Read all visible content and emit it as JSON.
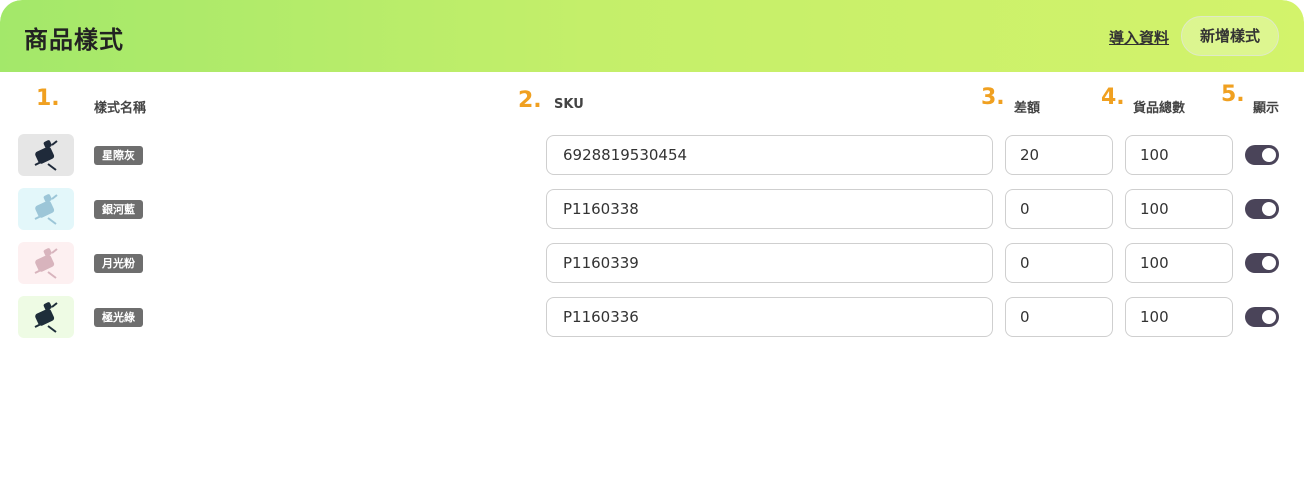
{
  "header": {
    "title": "商品樣式",
    "import_label": "導入資料",
    "add_label": "新增樣式"
  },
  "columns": [
    {
      "num": "1.",
      "label": "樣式名稱"
    },
    {
      "num": "2.",
      "label": "SKU"
    },
    {
      "num": "3.",
      "label": "差額"
    },
    {
      "num": "4.",
      "label": "貨品總數"
    },
    {
      "num": "5.",
      "label": "顯示"
    }
  ],
  "rows": [
    {
      "name": "星際灰",
      "sku": "6928819530454",
      "diff": "20",
      "stock": "100",
      "visible": true,
      "thumb_bg": "#e6e6e6",
      "item_color": "#1f2a3a"
    },
    {
      "name": "銀河藍",
      "sku": "P1160338",
      "diff": "0",
      "stock": "100",
      "visible": true,
      "thumb_bg": "#e3f7fa",
      "item_color": "#9cc6d8"
    },
    {
      "name": "月光粉",
      "sku": "P1160339",
      "diff": "0",
      "stock": "100",
      "visible": true,
      "thumb_bg": "#fdf0f1",
      "item_color": "#d8b4bd"
    },
    {
      "name": "極光綠",
      "sku": "P1160336",
      "diff": "0",
      "stock": "100",
      "visible": true,
      "thumb_bg": "#eefbe4",
      "item_color": "#1e2e3a"
    }
  ],
  "colors": {
    "header_start": "#a3e86a",
    "header_end": "#d3f36b",
    "accent_number": "#f0a020",
    "toggle_on": "#4a4459"
  }
}
